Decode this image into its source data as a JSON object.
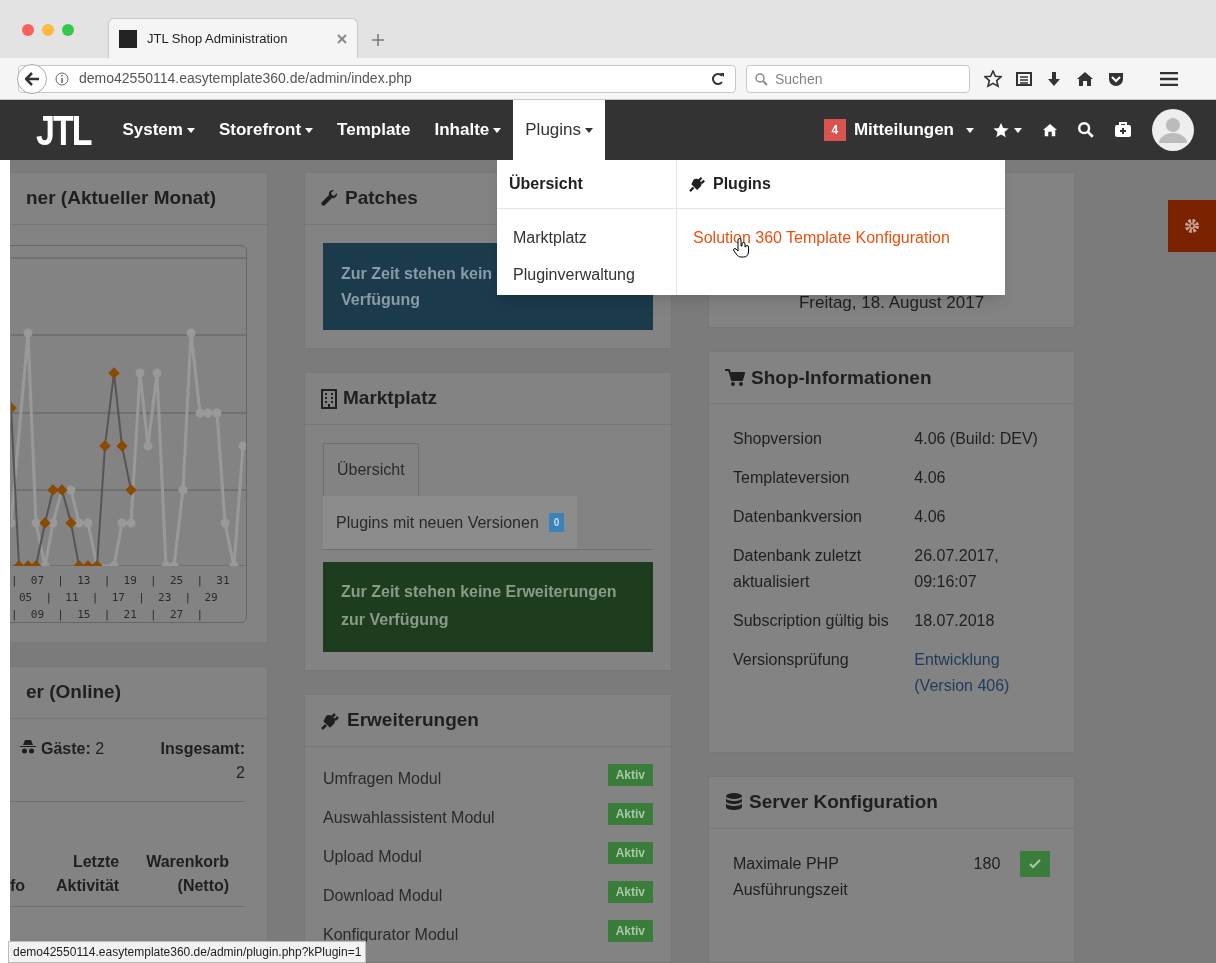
{
  "browser": {
    "tab_title": "JTL Shop Administration",
    "url": "demo42550114.easytemplate360.de/admin/index.php",
    "search": {
      "placeholder": "Suchen"
    }
  },
  "nav": {
    "logo": "JTL",
    "items": [
      {
        "label": "System",
        "dropdown": true,
        "selected": false
      },
      {
        "label": "Storefront",
        "dropdown": true,
        "selected": false
      },
      {
        "label": "Template",
        "dropdown": false,
        "selected": false
      },
      {
        "label": "Inhalte",
        "dropdown": true,
        "selected": false
      },
      {
        "label": "Plugins",
        "dropdown": true,
        "selected": true
      }
    ],
    "notifications": {
      "count": "4",
      "label": "Mitteilungen"
    }
  },
  "dropdown": {
    "columns": [
      {
        "heading": "Übersicht",
        "icon": false,
        "items": [
          {
            "label": "Marktplatz",
            "hovered": false
          },
          {
            "label": "Pluginverwaltung",
            "hovered": false
          }
        ]
      },
      {
        "heading": "Plugins",
        "icon": true,
        "items": [
          {
            "label": "Solution 360 Template Konfiguration",
            "hovered": true
          }
        ]
      }
    ]
  },
  "left": {
    "chart_panel": {
      "title": "ner (Aktueller Monat)",
      "x_label_rows": [
        "|  07  |  13  |  19  |  25  |  31",
        "05  |  11  |  17  |  23  |  29",
        "|  09  |  15  |  21  |  27  |"
      ]
    },
    "online_panel": {
      "title": "er (Online)",
      "guests_label": "Gäste:",
      "guests": "2",
      "total_label": "Insgesamt:",
      "total": "2",
      "columns": [
        "fo",
        "Letzte Aktivität",
        "Warenkorb (Netto)"
      ]
    }
  },
  "middle": {
    "patches": {
      "title": "Patches",
      "message_lines": [
        "Zur Zeit stehen kein",
        "Verfügung"
      ]
    },
    "marktplatz": {
      "title": "Marktplatz",
      "tabs": [
        {
          "label": "Übersicht",
          "selected": true
        },
        {
          "label": "Plugins mit neuen Versionen",
          "badge": "0",
          "selected": false
        }
      ],
      "message": "Zur Zeit stehen keine Erweiterungen zur Verfügung"
    },
    "erweiterungen": {
      "title": "Erweiterungen",
      "items": [
        {
          "name": "Umfragen Modul",
          "status": "Aktiv"
        },
        {
          "name": "Auswahlassistent Modul",
          "status": "Aktiv"
        },
        {
          "name": "Upload Modul",
          "status": "Aktiv"
        },
        {
          "name": "Download Modul",
          "status": "Aktiv"
        },
        {
          "name": "Konfigurator Modul",
          "status": "Aktiv"
        }
      ]
    }
  },
  "right": {
    "date": "Freitag, 18. August 2017",
    "shop_info": {
      "title": "Shop-Informationen",
      "rows": [
        {
          "label": "Shopversion",
          "value": "4.06 (Build: DEV)",
          "kind": "text"
        },
        {
          "label": "Templateversion",
          "value": "4.06",
          "kind": "text"
        },
        {
          "label": "Datenbankversion",
          "value": "4.06",
          "kind": "text"
        },
        {
          "label": "Datenbank zuletzt aktualisiert",
          "value": "26.07.2017, 09:16:07",
          "kind": "text"
        },
        {
          "label": "Subscription gültig bis",
          "value": "18.07.2018",
          "kind": "text"
        },
        {
          "label": "Versionsprüfung",
          "value": "Entwicklung (Version 406)",
          "kind": "link"
        }
      ]
    },
    "server": {
      "title": "Server Konfiguration",
      "rows": [
        {
          "label": "Maximale PHP Ausführungszeit",
          "value": "180",
          "ok": true
        }
      ]
    }
  },
  "status_url": "demo42550114.easytemplate360.de/admin/plugin.php?kPlugin=1"
}
